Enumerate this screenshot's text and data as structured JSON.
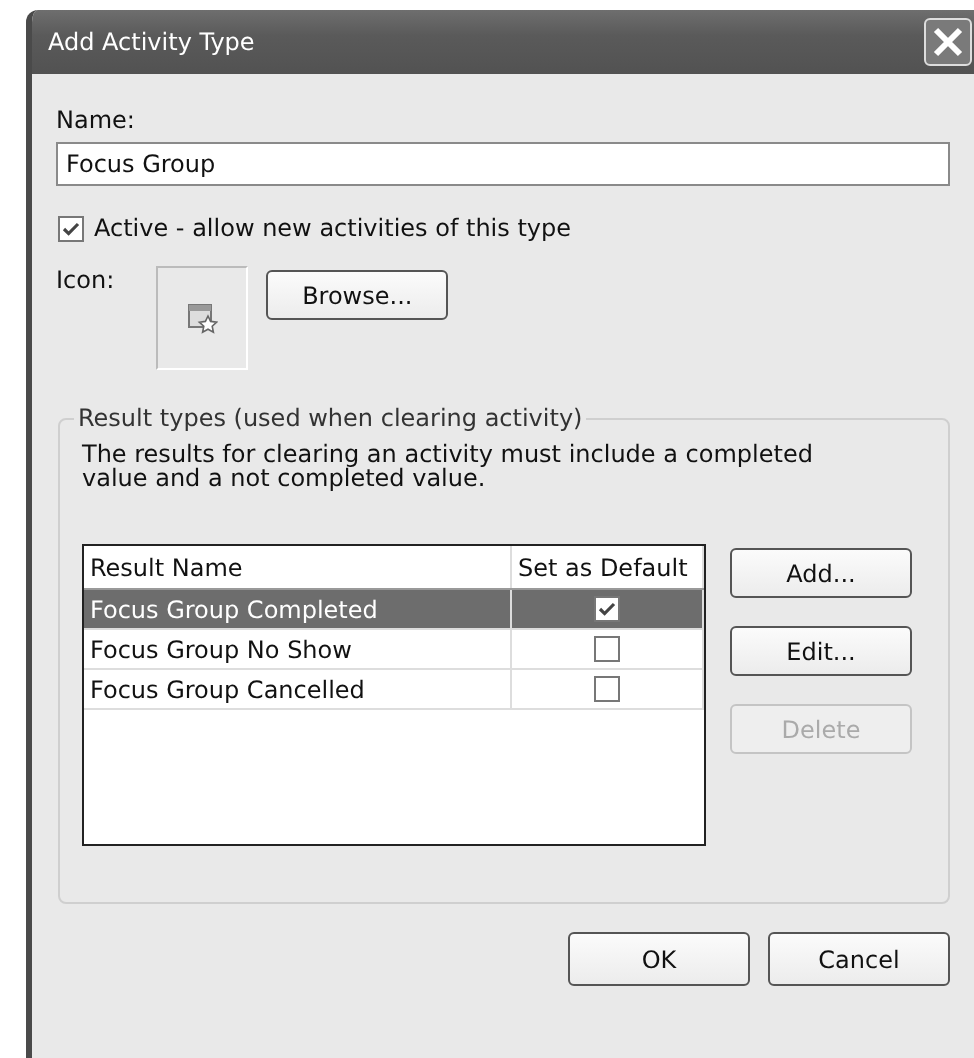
{
  "window": {
    "title": "Add Activity Type"
  },
  "name_field": {
    "label": "Name:",
    "value": "Focus Group"
  },
  "active": {
    "label": "Active - allow new activities of this type",
    "checked": true
  },
  "icon": {
    "label": "Icon:"
  },
  "browse_button": "Browse...",
  "result_types": {
    "legend": "Result types (used when clearing activity)",
    "description": "The results for clearing an activity must include a completed value and a not completed value.",
    "table": {
      "columns": [
        "Result Name",
        "Set as Default"
      ],
      "rows": [
        {
          "name": "Focus Group Completed",
          "default": true,
          "selected": true
        },
        {
          "name": "Focus Group No Show",
          "default": false,
          "selected": false
        },
        {
          "name": "Focus Group Cancelled",
          "default": false,
          "selected": false
        }
      ]
    },
    "buttons": [
      {
        "label": "Add...",
        "disabled": false
      },
      {
        "label": "Edit...",
        "disabled": false
      },
      {
        "label": "Delete",
        "disabled": true
      }
    ]
  },
  "footer_buttons": [
    "OK",
    "Cancel"
  ]
}
